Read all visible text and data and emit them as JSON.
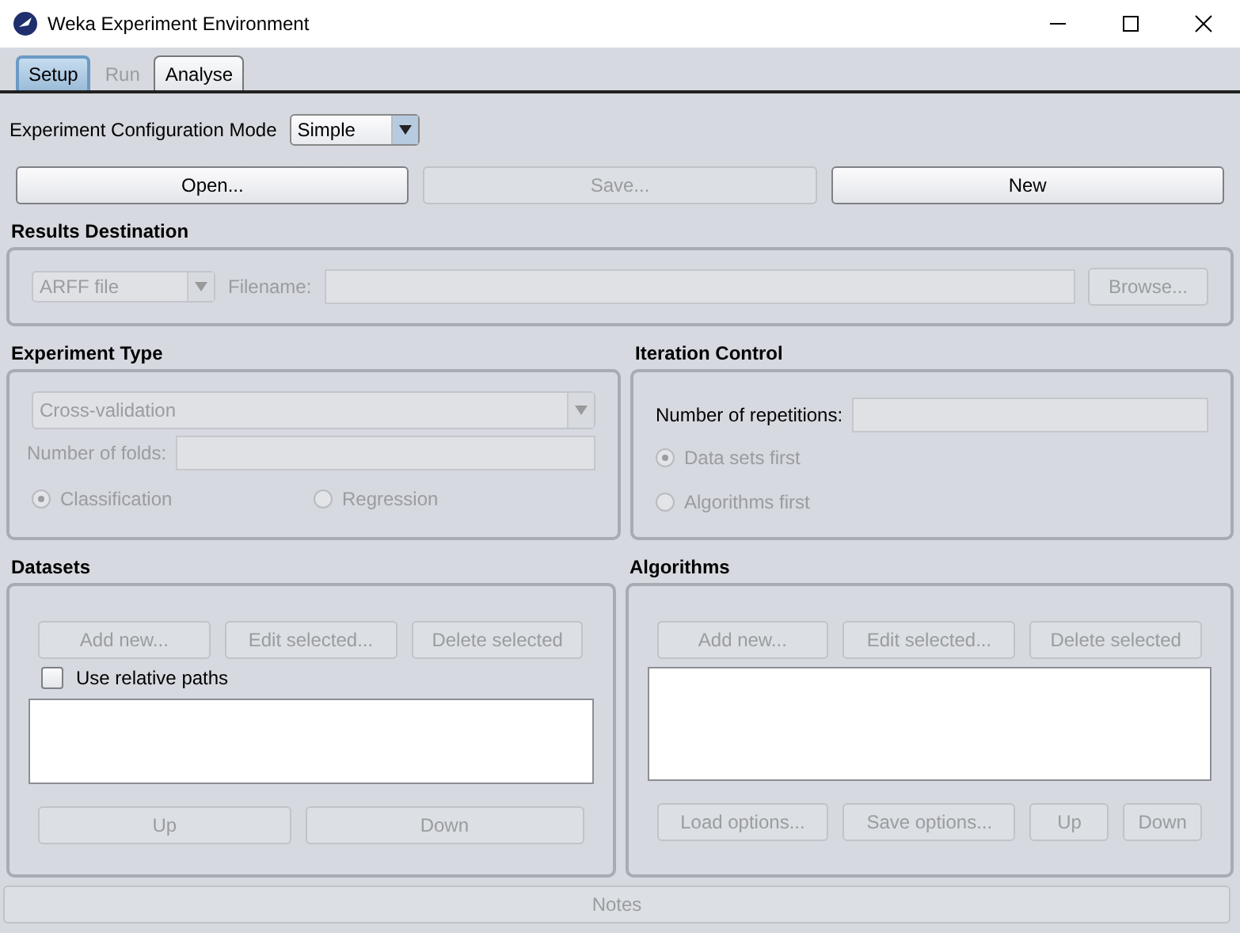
{
  "window": {
    "title": "Weka Experiment Environment"
  },
  "tabs": [
    {
      "label": "Setup",
      "selected": true,
      "disabled": false
    },
    {
      "label": "Run",
      "selected": false,
      "disabled": true
    },
    {
      "label": "Analyse",
      "selected": false,
      "disabled": false
    }
  ],
  "mode": {
    "label": "Experiment Configuration Mode",
    "value": "Simple"
  },
  "file_buttons": [
    {
      "label": "Open...",
      "disabled": false
    },
    {
      "label": "Save...",
      "disabled": true
    },
    {
      "label": "New",
      "disabled": false
    }
  ],
  "results_destination": {
    "title": "Results Destination",
    "format": "ARFF file",
    "filename_label": "Filename:",
    "browse": "Browse...",
    "disabled": true
  },
  "experiment_type": {
    "title": "Experiment Type",
    "type": "Cross-validation",
    "folds_label": "Number of folds:",
    "disabled": true,
    "options": [
      {
        "label": "Classification",
        "selected": true
      },
      {
        "label": "Regression",
        "selected": false
      }
    ]
  },
  "iteration_control": {
    "title": "Iteration Control",
    "repetitions_label": "Number of repetitions:",
    "options_disabled": true,
    "options": [
      {
        "label": "Data sets first",
        "selected": true
      },
      {
        "label": "Algorithms first",
        "selected": false
      }
    ]
  },
  "datasets": {
    "title": "Datasets",
    "buttons": [
      {
        "label": "Add new...",
        "disabled": true
      },
      {
        "label": "Edit selected...",
        "disabled": true
      },
      {
        "label": "Delete selected",
        "disabled": true
      }
    ],
    "relative_paths": {
      "label": "Use relative paths",
      "checked": false
    },
    "move_buttons": [
      {
        "label": "Up",
        "disabled": true
      },
      {
        "label": "Down",
        "disabled": true
      }
    ]
  },
  "algorithms": {
    "title": "Algorithms",
    "buttons": [
      {
        "label": "Add new...",
        "disabled": true
      },
      {
        "label": "Edit selected...",
        "disabled": true
      },
      {
        "label": "Delete selected",
        "disabled": true
      }
    ],
    "option_buttons": [
      {
        "label": "Load options...",
        "disabled": true
      },
      {
        "label": "Save options...",
        "disabled": true
      },
      {
        "label": "Up",
        "disabled": true
      },
      {
        "label": "Down",
        "disabled": true
      }
    ]
  },
  "notes": {
    "label": "Notes",
    "disabled": true
  }
}
